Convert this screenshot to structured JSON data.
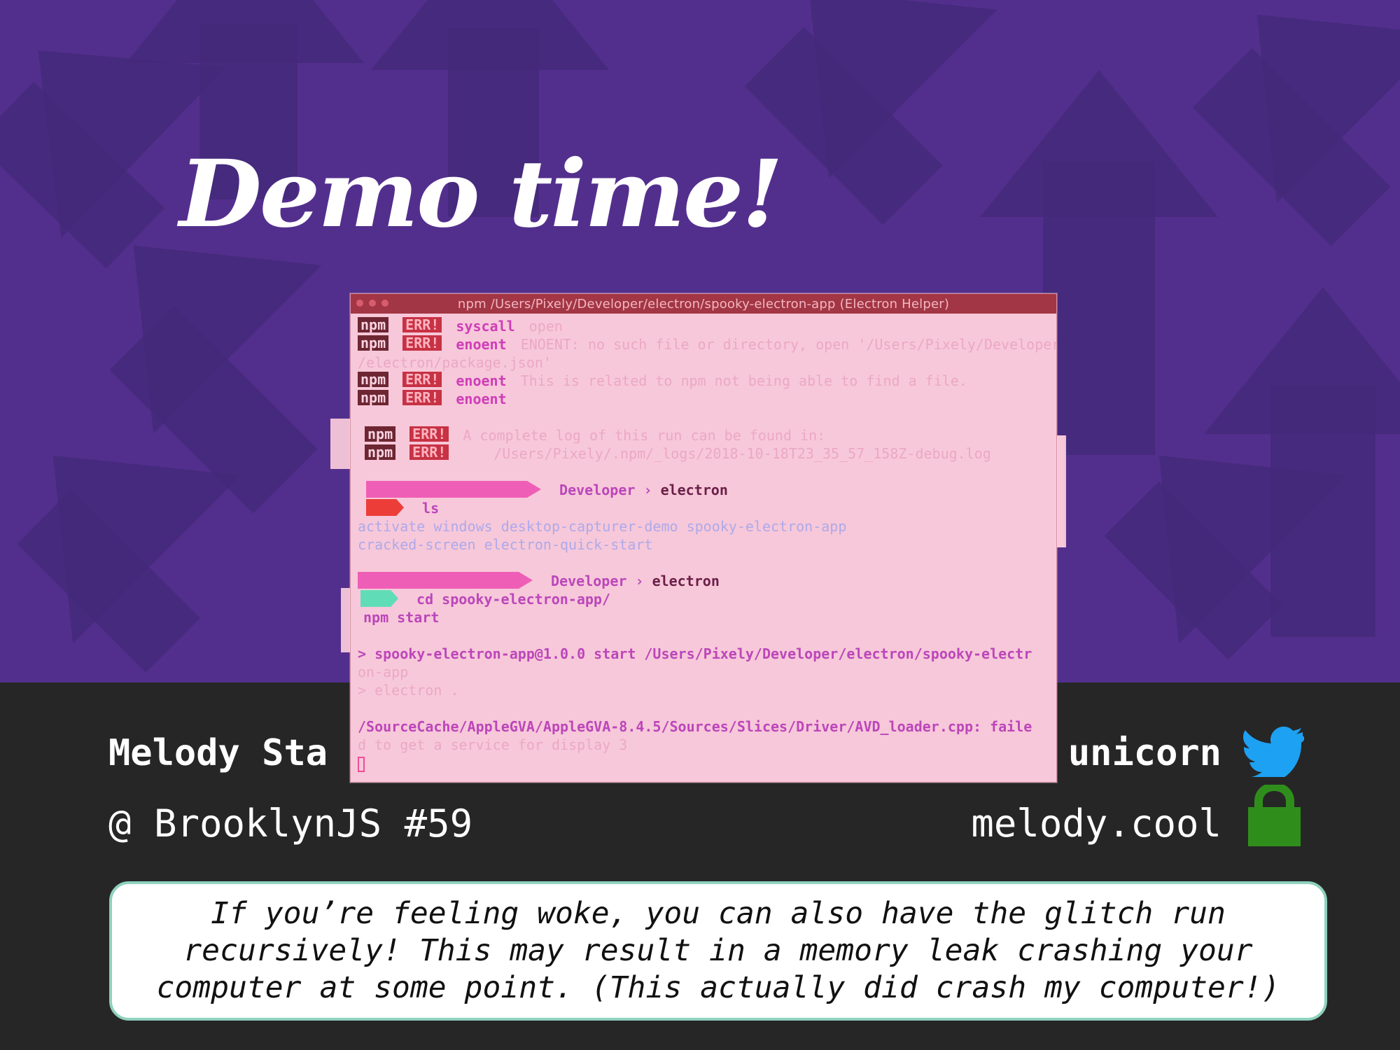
{
  "slide": {
    "title": "Demo time!",
    "speaker_name": "Melody Sta",
    "event": "@ BrooklynJS #59",
    "twitter_handle": "unicorn",
    "website": "melody.cool",
    "note": "If you’re feeling woke, you can also have the glitch run recursively! This may result in a memory leak crashing your computer at some point. (This actually did crash my computer!)",
    "colors": {
      "purple": "#532f8d",
      "dark": "#262626",
      "accent_mint": "#8fd1be",
      "twitter_blue": "#1da1f2",
      "lock_green": "#2f8e1b"
    },
    "icons": {
      "twitter": "twitter-icon",
      "lock": "lock-icon"
    }
  },
  "terminal": {
    "title": "npm /Users/Pixely/Developer/electron/spooky-electron-app (Electron Helper)",
    "lines": {
      "l1": {
        "npm": "npm",
        "err": "ERR!",
        "key": "syscall",
        "text": "open"
      },
      "l2": {
        "npm": "npm",
        "err": "ERR!",
        "key": "enoent",
        "text": "ENOENT: no such file or directory, open '/Users/Pixely/Developer"
      },
      "l3": {
        "text": "/electron/package.json'"
      },
      "l4": {
        "npm": "npm",
        "err": "ERR!",
        "key": "enoent",
        "text": "This is related to npm not being able to find a file."
      },
      "l5": {
        "npm": "npm",
        "err": "ERR!",
        "key": "enoent"
      },
      "l6": {
        "npm": "npm",
        "err": "ERR!",
        "text": "A complete log of this run can be found in:"
      },
      "l7": {
        "npm": "npm",
        "err": "ERR!",
        "text": "/Users/Pixely/.npm/_logs/2018-10-18T23_35_57_158Z-debug.log"
      },
      "l8": {
        "developer": "Developer",
        "electron": "electron"
      },
      "l9": {
        "prompt": "$",
        "text": "ls"
      },
      "l10": {
        "text": "activate windows          desktop-capturer-demo spooky-electron-app"
      },
      "l11": {
        "text": "cracked-screen           electron-quick-start"
      },
      "l12": {
        "developer": "Developer",
        "electron": "electron"
      },
      "l13": {
        "text": "cd spooky-electron-app/"
      },
      "l14": {
        "text": "npm start"
      },
      "l15": {
        "text": "> spooky-electron-app@1.0.0 start /Users/Pixely/Developer/electron/spooky-electr"
      },
      "l16": {
        "text": "on-app"
      },
      "l17": {
        "text": "> electron ."
      },
      "l18": {
        "text": "/SourceCache/AppleGVA/AppleGVA-8.4.5/Sources/Slices/Driver/AVD_loader.cpp: faile"
      },
      "l19": {
        "text": "d to get a service for display 3"
      }
    }
  }
}
